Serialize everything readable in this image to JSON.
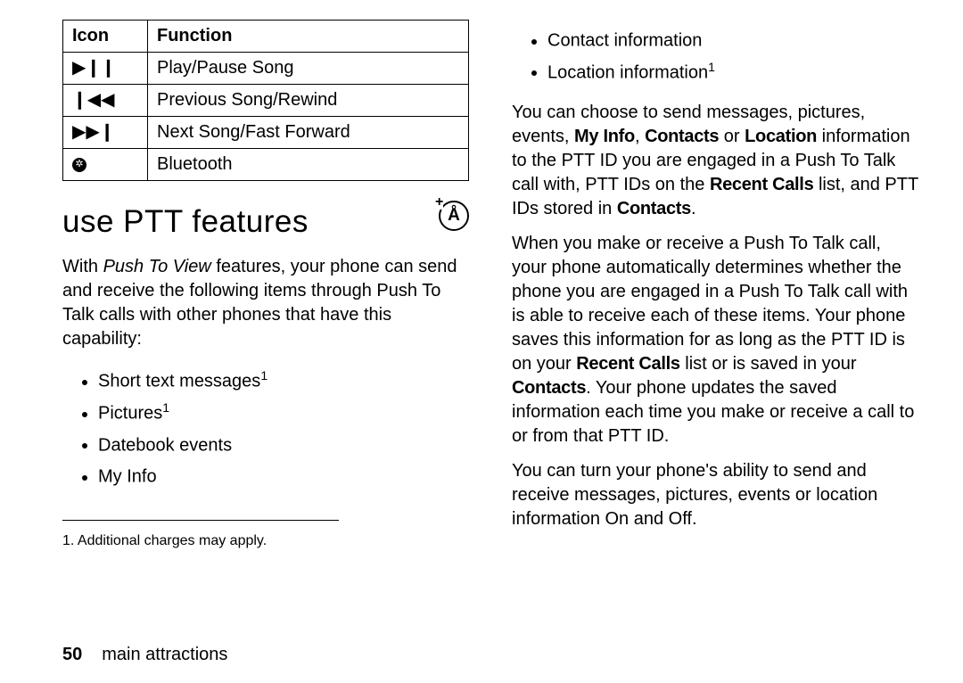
{
  "table": {
    "headers": {
      "icon": "Icon",
      "function": "Function"
    },
    "rows": [
      {
        "icon": "▶❙❙",
        "function": "Play/Pause Song"
      },
      {
        "icon": "❙◀◀",
        "function": "Previous Song/Rewind"
      },
      {
        "icon": "▶▶❙",
        "function": "Next Song/Fast Forward"
      },
      {
        "icon": "bt",
        "function": "Bluetooth"
      }
    ]
  },
  "heading": "use PTT features",
  "intro": {
    "pre": "With ",
    "em": "Push To View",
    "post": " features, your phone can send and receive the following items through Push To Talk calls with other phones that have this capability:"
  },
  "left_bullets": [
    {
      "text": "Short text messages",
      "sup": "1"
    },
    {
      "text": "Pictures",
      "sup": "1"
    },
    {
      "text": "Datebook events",
      "sup": ""
    },
    {
      "text": "My Info",
      "sup": ""
    }
  ],
  "right_bullets": [
    {
      "text": "Contact information",
      "sup": ""
    },
    {
      "text": "Location information",
      "sup": "1"
    }
  ],
  "para1": {
    "parts": [
      {
        "t": "text",
        "v": "You can choose to send messages, pictures, events, "
      },
      {
        "t": "b",
        "v": "My Info"
      },
      {
        "t": "text",
        "v": ", "
      },
      {
        "t": "b",
        "v": "Contacts"
      },
      {
        "t": "text",
        "v": " or "
      },
      {
        "t": "b",
        "v": "Location"
      },
      {
        "t": "text",
        "v": " information to the PTT ID you are engaged in a Push To Talk call with, PTT IDs on the "
      },
      {
        "t": "b",
        "v": "Recent Calls"
      },
      {
        "t": "text",
        "v": " list, and PTT IDs stored in "
      },
      {
        "t": "b",
        "v": "Contacts"
      },
      {
        "t": "text",
        "v": "."
      }
    ]
  },
  "para2": {
    "parts": [
      {
        "t": "text",
        "v": "When you make or receive a Push To Talk call, your phone automatically determines whether the phone you are engaged in a Push To Talk call with is able to receive each of these items. Your phone saves this information for as long as the PTT ID is on your "
      },
      {
        "t": "b",
        "v": "Recent Calls"
      },
      {
        "t": "text",
        "v": " list or is saved in your "
      },
      {
        "t": "b",
        "v": "Contacts"
      },
      {
        "t": "text",
        "v": ". Your phone updates the saved information each time you make or receive a call to or from that PTT ID."
      }
    ]
  },
  "para3": "You can turn your phone's ability to send and receive messages, pictures, events or location information On and Off.",
  "footnote": "1.  Additional charges may apply.",
  "footer": {
    "page": "50",
    "section": "main attractions"
  }
}
